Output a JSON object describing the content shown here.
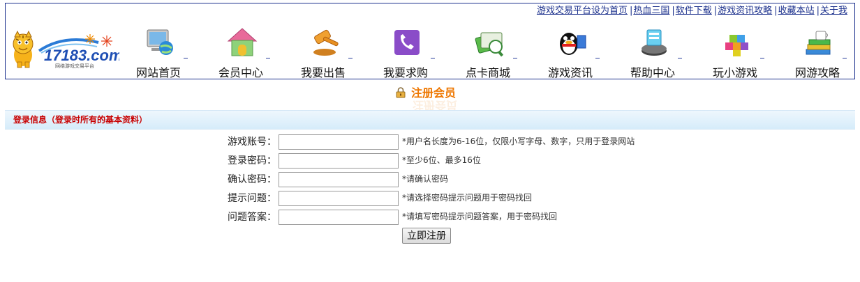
{
  "header": {
    "top_links": [
      "游戏交易平台设为首页",
      "热血三国",
      "软件下载",
      "游戏资讯攻略",
      "收藏本站",
      "关于我"
    ],
    "logo": {
      "text": "17183.com",
      "tagline": "网络游戏交易平台"
    },
    "nav": [
      {
        "label": "网站首页",
        "icon": "computer-globe-icon"
      },
      {
        "label": "会员中心",
        "icon": "house-icon"
      },
      {
        "label": "我要出售",
        "icon": "auction-hammer-icon"
      },
      {
        "label": "我要求购",
        "icon": "phone-icon"
      },
      {
        "label": "点卡商城",
        "icon": "card-icon"
      },
      {
        "label": "游戏资讯",
        "icon": "qq-penguin-icon"
      },
      {
        "label": "帮助中心",
        "icon": "help-device-icon"
      },
      {
        "label": "玩小游戏",
        "icon": "cubes-icon"
      },
      {
        "label": "网游攻略",
        "icon": "books-icon"
      }
    ]
  },
  "page": {
    "title": "注册会员",
    "section_title": "登录信息（登录时所有的基本资料）"
  },
  "form": {
    "fields": [
      {
        "label": "游戏账号：",
        "value": "",
        "hint": "*用户名长度为6-16位，仅限小写字母、数字，只用于登录网站"
      },
      {
        "label": "登录密码：",
        "value": "",
        "hint": "*至少6位、最多16位"
      },
      {
        "label": "确认密码：",
        "value": "",
        "hint": "*请确认密码"
      },
      {
        "label": "提示问题：",
        "value": "",
        "hint": "*请选择密码提示问题用于密码找回"
      },
      {
        "label": "问题答案：",
        "value": "",
        "hint": "*请填写密码提示问题答案，用于密码找回"
      }
    ],
    "submit_label": "立即注册"
  },
  "colors": {
    "frame_border": "#1a2f8c",
    "link": "#1a2f8c",
    "title_orange": "#ee7700",
    "section_title_red": "#c80000",
    "section_bar": "#d6ecfa"
  }
}
